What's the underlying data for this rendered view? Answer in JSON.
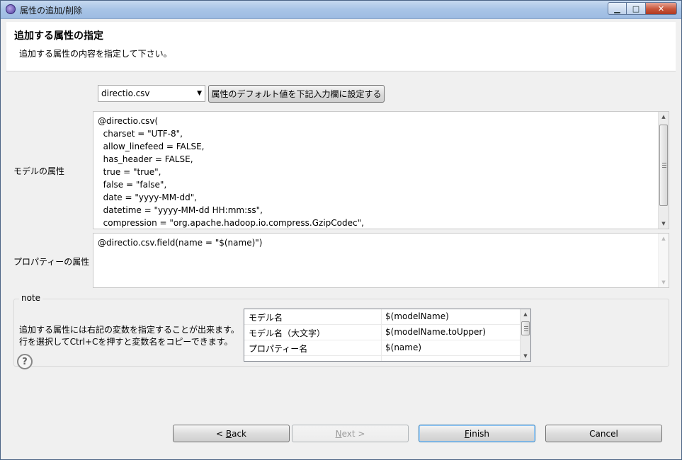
{
  "window": {
    "title": "属性の追加/削除",
    "controls": {
      "minimize": "▁",
      "maximize": "□",
      "close": "✕"
    }
  },
  "header": {
    "title": "追加する属性の指定",
    "description": "追加する属性の内容を指定して下さい。"
  },
  "form": {
    "template_select": {
      "value": "directio.csv"
    },
    "set_default_button": "属性のデフォルト値を下記入力欄に設定する",
    "model_attr_label": "モデルの属性",
    "model_attr_lines": [
      "@directio.csv(",
      "  charset = \"UTF-8\",",
      "  allow_linefeed = FALSE,",
      "  has_header = FALSE,",
      "  true = \"true\",",
      "  false = \"false\",",
      "  date = \"yyyy-MM-dd\",",
      "  datetime = \"yyyy-MM-dd HH:mm:ss\",",
      "  compression = \"org.apache.hadoop.io.compress.GzipCodec\","
    ],
    "property_attr_label": "プロパティーの属性",
    "property_attr_lines": [
      "@directio.csv.field(name = \"$(name)\")"
    ]
  },
  "note": {
    "legend": "note",
    "text_lines": [
      "追加する属性には右記の変数を指定することが出来ます。",
      "行を選択してCtrl+Cを押すと変数名をコピーできます。"
    ],
    "variables": [
      {
        "name": "モデル名",
        "var": "$(modelName)"
      },
      {
        "name": "モデル名（大文字）",
        "var": "$(modelName.toUpper)"
      },
      {
        "name": "プロパティー名",
        "var": "$(name)"
      }
    ]
  },
  "footer": {
    "help_icon": "?",
    "back": {
      "mnemonic": "B",
      "rest": "ack",
      "prefix": "< "
    },
    "next": {
      "mnemonic": "N",
      "rest": "ext",
      "suffix": " >"
    },
    "finish": {
      "mnemonic": "F",
      "rest": "inish"
    },
    "cancel": "Cancel"
  }
}
